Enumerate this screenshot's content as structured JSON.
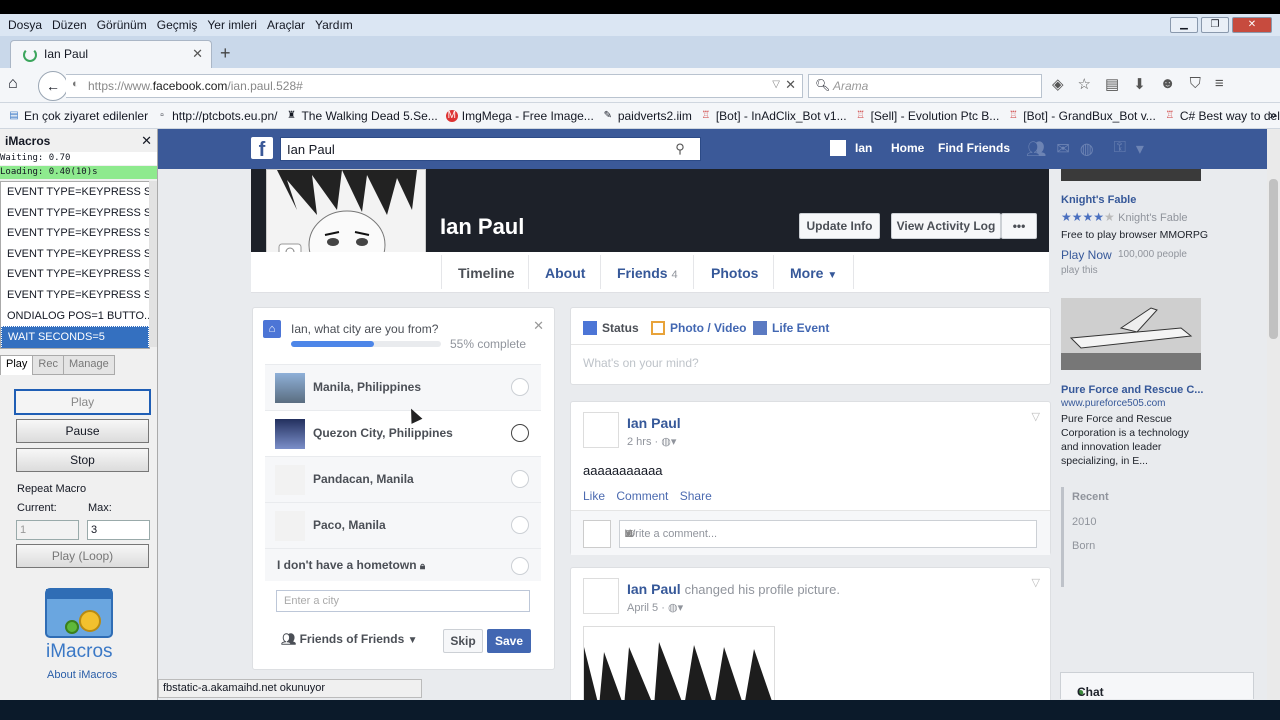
{
  "menubar": {
    "items": [
      "Dosya",
      "Düzen",
      "Görünüm",
      "Geçmiş",
      "Yer imleri",
      "Araçlar",
      "Yardım"
    ]
  },
  "tab": {
    "title": "Ian Paul",
    "new_tab": "+",
    "close": "✕"
  },
  "navbar": {
    "url_prefix": "https://www.",
    "url_domain": "facebook.com",
    "url_rest": "/ian.paul.528#",
    "search_placeholder": "Arama"
  },
  "bookmarks": [
    "En çok ziyaret edilenler",
    "http://ptcbots.eu.pn/",
    "The Walking Dead 5.Se...",
    "ImgMega - Free Image...",
    "paidverts2.iim",
    "[Bot] - InAdClix_Bot v1...",
    "[Sell] - Evolution Ptc B...",
    "[Bot] - GrandBux_Bot v...",
    "C# Best way to delay"
  ],
  "imacros": {
    "title": "iMacros",
    "waiting": "Waiting: 0.70",
    "loading": "Loading: 0.40(10)s",
    "macro_lines": [
      "EVENT TYPE=KEYPRESS SE...",
      "EVENT TYPE=KEYPRESS SE...",
      "EVENT TYPE=KEYPRESS SE...",
      "EVENT TYPE=KEYPRESS SE...",
      "EVENT TYPE=KEYPRESS SE...",
      "EVENT TYPE=KEYPRESS SE...",
      "ONDIALOG POS=1 BUTTO...",
      "WAIT SECONDS=5"
    ],
    "tabs": [
      "Play",
      "Rec",
      "Manage"
    ],
    "play": "Play",
    "pause": "Pause",
    "stop": "Stop",
    "repeat_label": "Repeat Macro",
    "current_label": "Current:",
    "max_label": "Max:",
    "current_value": "1",
    "max_value": "3",
    "play_loop": "Play (Loop)",
    "logo_text": "iMacros",
    "about": "About iMacros"
  },
  "facebook": {
    "search_value": "Ian Paul",
    "nav_user": "Ian",
    "nav_home": "Home",
    "nav_find_friends": "Find Friends",
    "profile_name": "Ian Paul",
    "update_info": "Update Info",
    "view_activity_log": "View Activity Log",
    "more_dots": "•••",
    "tabs": {
      "timeline": "Timeline",
      "about": "About",
      "friends": "Friends",
      "friends_count": "4",
      "photos": "Photos",
      "more": "More"
    },
    "hometown": {
      "question": "Ian, what city are you from?",
      "progress": 0.55,
      "progress_label": "55% complete",
      "options": [
        "Manila, Philippines",
        "Quezon City, Philippines",
        "Pandacan, Manila",
        "Paco, Manila"
      ],
      "no_hometown": "I don't have a hometown",
      "city_placeholder": "Enter a city",
      "audience": "Friends of Friends",
      "skip": "Skip",
      "save": "Save"
    },
    "composer": {
      "status": "Status",
      "photo_video": "Photo / Video",
      "life_event": "Life Event",
      "placeholder": "What's on your mind?"
    },
    "post1": {
      "author": "Ian Paul",
      "time": "2 hrs",
      "text": "aaaaaaaaaaa",
      "like": "Like",
      "comment": "Comment",
      "share": "Share",
      "comment_placeholder": "Write a comment..."
    },
    "post2": {
      "author": "Ian Paul",
      "action": "changed his profile picture.",
      "time": "April 5"
    },
    "ads": {
      "ad1_title": "Knight's Fable",
      "ad1_sub": "Knight's Fable",
      "ad1_text": "Free to play browser MMORPG",
      "ad1_cta": "Play Now",
      "ad1_meta": "100,000 people",
      "ad1_meta2": "play this",
      "ad2_title": "Pure Force and Rescue C...",
      "ad2_url": "www.pureforce505.com",
      "ad2_text": "Pure Force and Rescue Corporation is a technology and innovation leader specializing, in E..."
    },
    "timeline_nav": [
      "Recent",
      "2010",
      "Born"
    ],
    "chat": "Chat"
  },
  "statusbar": "fbstatic-a.akamaihd.net okunuyor",
  "colors": {
    "facebook_blue": "#3b5998",
    "link_blue": "#365899",
    "imacros_loading": "#8eea8e",
    "selection": "#3470c0"
  }
}
